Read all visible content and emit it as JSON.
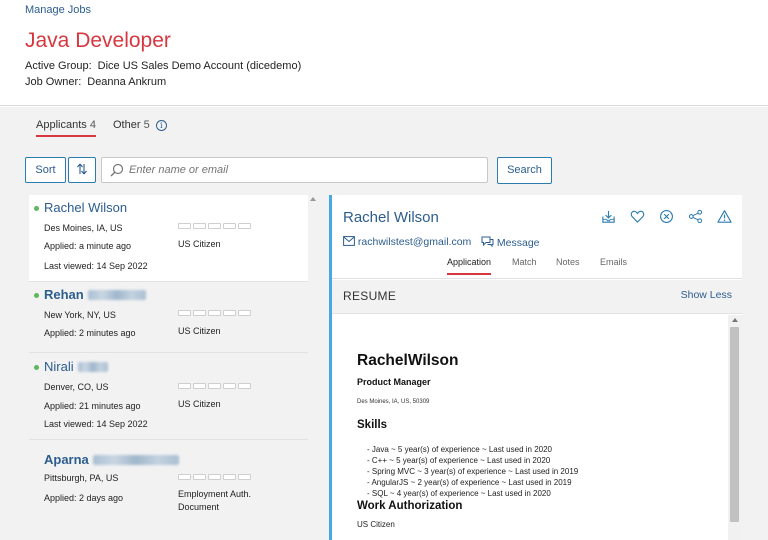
{
  "header": {
    "breadcrumb": "Manage Jobs",
    "title": "Java Developer",
    "active_group_label": "Active Group:",
    "active_group_value": "Dice US Sales Demo Account (dicedemo)",
    "job_owner_label": "Job Owner:",
    "job_owner_value": "Deanna Ankrum"
  },
  "tabs": {
    "applicants_label": "Applicants",
    "applicants_count": "4",
    "other_label": "Other",
    "other_count": "5"
  },
  "toolbar": {
    "sort_label": "Sort",
    "order_icon": "sort-order-icon",
    "search_placeholder": "Enter name or email",
    "search_button": "Search"
  },
  "applicants": [
    {
      "name": "Rachel Wilson",
      "location": "Des Moines, IA, US",
      "applied": "Applied: a minute ago",
      "last_viewed": "Last viewed: 14 Sep 2022",
      "authorization": "US Citizen",
      "online": true
    },
    {
      "name": "Rehan",
      "location": "New York, NY, US",
      "applied": "Applied: 2 minutes ago",
      "last_viewed": "",
      "authorization": "US Citizen",
      "online": true
    },
    {
      "name": "Nirali",
      "location": "Denver, CO, US",
      "applied": "Applied: 21 minutes ago",
      "last_viewed": "Last viewed: 14 Sep 2022",
      "authorization": "US Citizen",
      "online": true
    },
    {
      "name": "Aparna",
      "location": "Pittsburgh, PA, US",
      "applied": "Applied: 2 days ago",
      "last_viewed": "",
      "authorization_line1": "Employment Auth.",
      "authorization_line2": "Document",
      "online": false
    }
  ],
  "detail": {
    "name": "Rachel Wilson",
    "email": "rachwilstest@gmail.com",
    "message_label": "Message",
    "tabs": [
      "Application",
      "Match",
      "Notes",
      "Emails"
    ],
    "resume_label": "RESUME",
    "show_less": "Show Less"
  },
  "resume": {
    "name": "RachelWilson",
    "role": "Product Manager",
    "location": "Des Moines, IA, US, 50309",
    "skills_heading": "Skills",
    "skills": [
      "- Java ~ 5 year(s) of experience ~ Last used in 2020",
      "- C++ ~ 5 year(s) of experience ~ Last used in 2020",
      "- Spring MVC ~ 3 year(s) of experience ~ Last used in 2019",
      "- AngularJS ~ 2 year(s) of experience ~ Last used in 2019",
      "- SQL ~ 4 year(s) of experience ~ Last used in 2020"
    ],
    "work_auth_heading": "Work Authorization",
    "work_auth_value": "US Citizen"
  },
  "colors": {
    "accent_red": "#d7373f",
    "link_blue": "#2c5d8f",
    "online_green": "#5cb85c",
    "panel_border": "#4aa8e0"
  }
}
